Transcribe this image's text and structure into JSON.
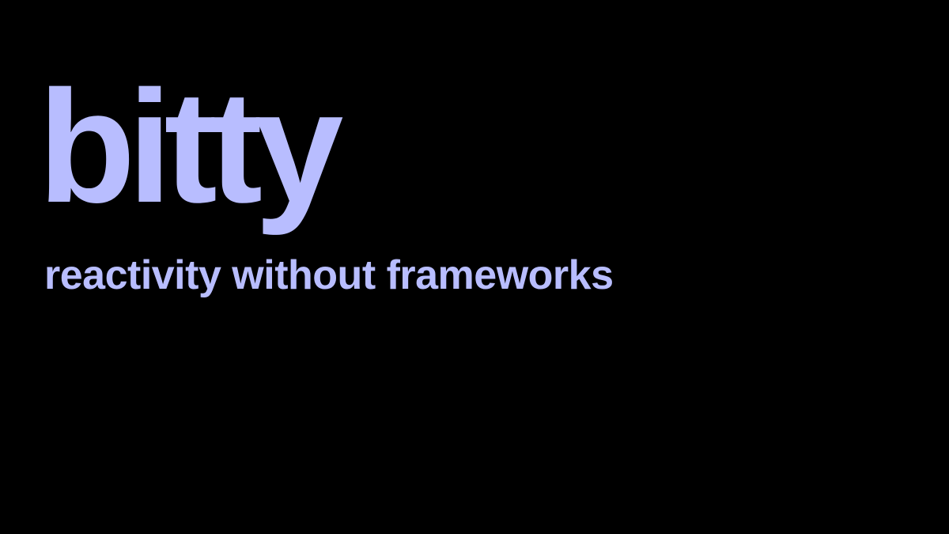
{
  "title": "bitty",
  "tagline": "reactivity without frameworks",
  "colors": {
    "background": "#000000",
    "text": "#b8bdff"
  }
}
